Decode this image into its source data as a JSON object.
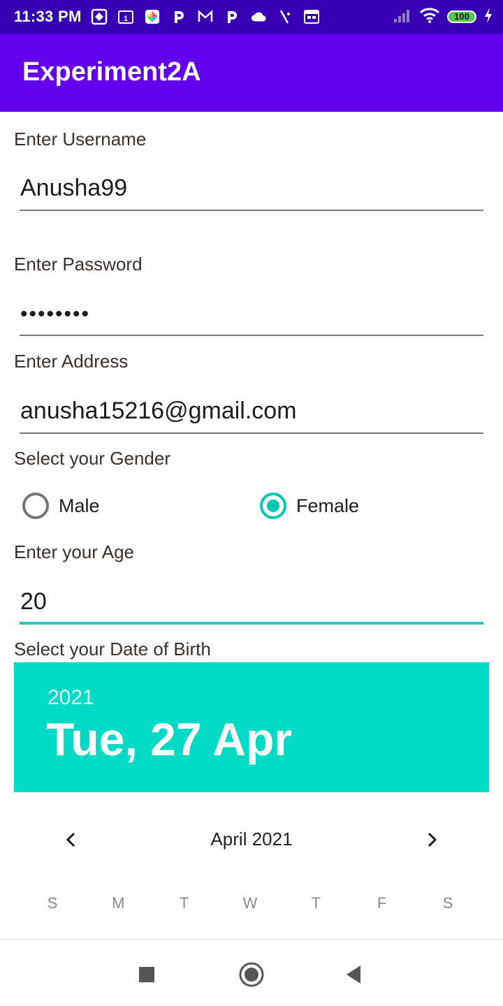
{
  "status_bar": {
    "time": "11:33 PM",
    "battery": "100",
    "icons": [
      "photos-icon",
      "calendar-1-icon",
      "pinwheel-icon",
      "paytm-p-icon",
      "gmail-icon",
      "paytm-p-icon",
      "cloud-icon",
      "slash-icon",
      "calendar-icon",
      "signal-icon",
      "wifi-icon",
      "battery-icon",
      "charging-icon"
    ]
  },
  "app_bar": {
    "title": "Experiment2A"
  },
  "form": {
    "username": {
      "label": "Enter Username",
      "value": "Anusha99"
    },
    "password": {
      "label": "Enter Password",
      "value": "••••••••"
    },
    "address": {
      "label": "Enter Address",
      "value": "anusha15216@gmail.com"
    },
    "gender": {
      "label": "Select your Gender",
      "options": [
        {
          "label": "Male",
          "checked": false
        },
        {
          "label": "Female",
          "checked": true
        }
      ]
    },
    "age": {
      "label": "Enter your Age",
      "value": "20"
    },
    "dob": {
      "label": "Select your Date of Birth"
    }
  },
  "date_picker": {
    "year": "2021",
    "date": "Tue, 27 Apr",
    "month": "April 2021",
    "weekdays": [
      "S",
      "M",
      "T",
      "W",
      "T",
      "F",
      "S"
    ],
    "accent_color": "#03dac5"
  },
  "colors": {
    "status_bar": "#3700b3",
    "app_bar": "#6200ee",
    "accent": "#03dac5"
  }
}
